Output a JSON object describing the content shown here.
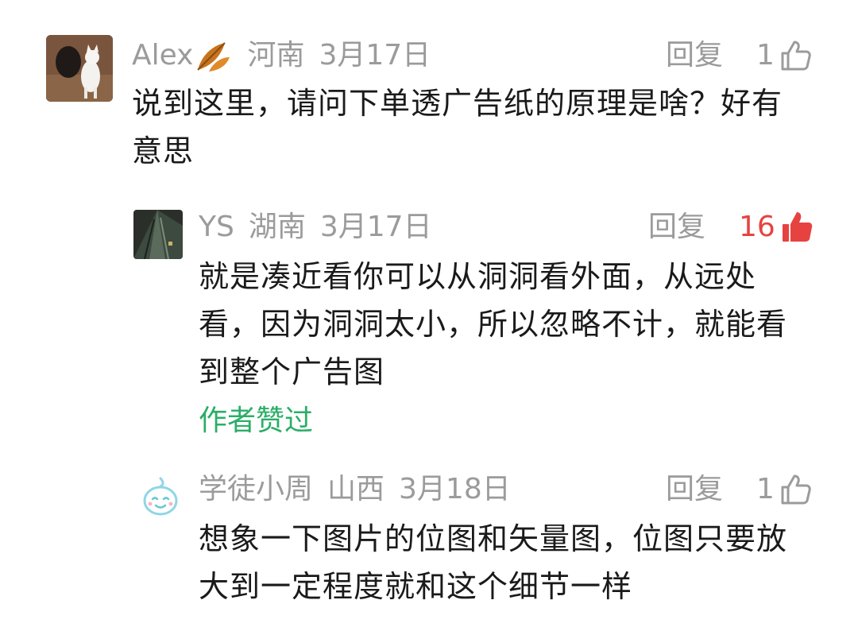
{
  "comments": [
    {
      "username": "Alex",
      "location": "河南",
      "date": "3月17日",
      "reply_label": "回复",
      "likes": "1",
      "text": "说到这里，请问下单透广告纸的原理是啥？好有意思",
      "liked_by_me": false,
      "avatar_icon": "white-cat-avatar",
      "name_emoji": "fallen-leaf-icon"
    },
    {
      "username": "YS",
      "location": "湖南",
      "date": "3月17日",
      "reply_label": "回复",
      "likes": "16",
      "text": "就是凑近看你可以从洞洞看外面，从远处看，因为洞洞太小，所以忽略不计，就能看到整个广告图",
      "author_liked": "作者赞过",
      "liked_by_me": true,
      "avatar_icon": "building-photo-avatar"
    },
    {
      "username": "学徒小周",
      "location": "山西",
      "date": "3月18日",
      "reply_label": "回复",
      "likes": "1",
      "text": "想象一下图片的位图和矢量图，位图只要放大到一定程度就和这个细节一样",
      "liked_by_me": false,
      "avatar_icon": "cartoon-face-avatar"
    }
  ],
  "colors": {
    "meta": "#9b9b9b",
    "text": "#1a1a1a",
    "like_active": "#e64340",
    "author_liked": "#2aae67"
  }
}
